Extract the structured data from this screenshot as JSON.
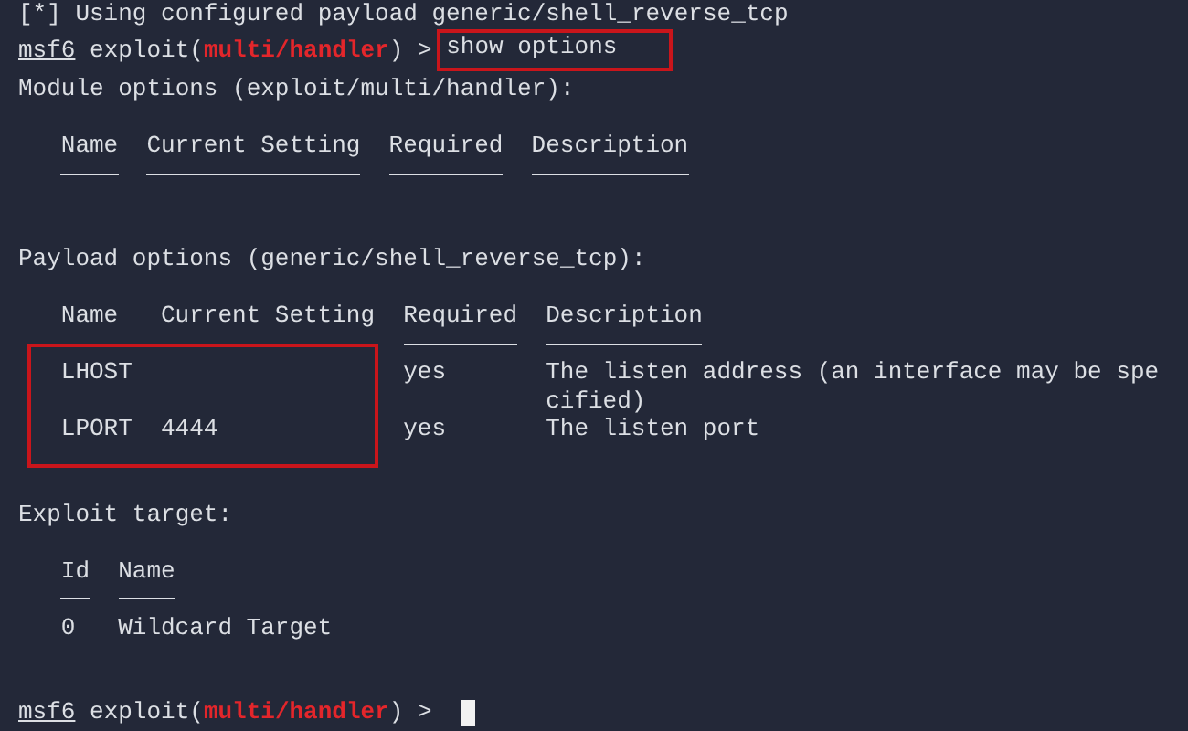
{
  "top_line": "[*] Using configured payload generic/shell_reverse_tcp",
  "command_prompt": {
    "name": "msf6",
    "module_prefix": "exploit(",
    "module": "multi/handler",
    "module_suffix": ") >",
    "command": "show options",
    "command_highlighted": true
  },
  "sections": [
    {
      "title": "Module options (exploit/multi/handler):",
      "columns": [
        "Name",
        "Current Setting",
        "Required",
        "Description"
      ]
    },
    {
      "title": "Payload options (generic/shell_reverse_tcp):",
      "columns": [
        "Name",
        "Current Setting",
        "Required",
        "Description"
      ],
      "rows": [
        [
          "LHOST",
          "",
          "yes",
          "The listen address (an interface may be specified)"
        ],
        [
          "LPORT",
          "4444",
          "yes",
          "The listen port"
        ]
      ],
      "rows_highlighted": true
    },
    {
      "title": "Exploit target:",
      "columns": [
        "Id",
        "Name"
      ],
      "rows": [
        [
          "0",
          "Wildcard Target"
        ]
      ]
    }
  ],
  "final_prompt": {
    "name": "msf6",
    "module_prefix": "exploit(",
    "module": "multi/handler",
    "module_suffix": ") >",
    "cursor": true
  }
}
